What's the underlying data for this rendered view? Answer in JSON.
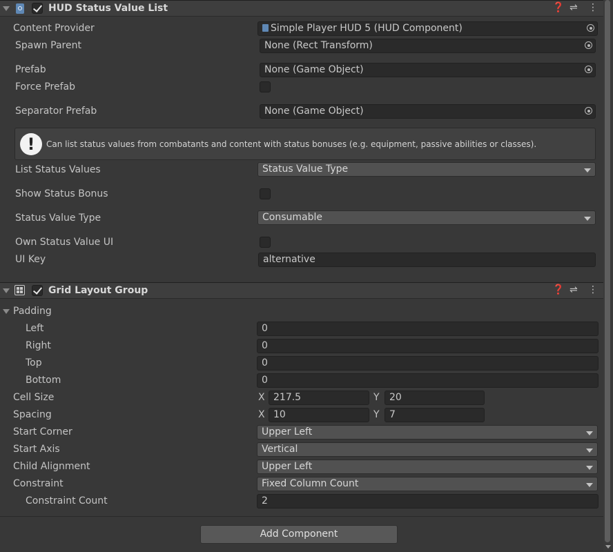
{
  "component1": {
    "title": "HUD Status Value List",
    "icon": "script-icon",
    "enabled": true,
    "fields": {
      "content_provider": {
        "label": "Content Provider",
        "value": "Simple Player HUD 5 (HUD Component)"
      },
      "spawn_parent": {
        "label": "Spawn Parent",
        "value": "None (Rect Transform)"
      },
      "prefab": {
        "label": "Prefab",
        "value": "None (Game Object)"
      },
      "force_prefab": {
        "label": "Force Prefab",
        "checked": false
      },
      "separator_prefab": {
        "label": "Separator Prefab",
        "value": "None (Game Object)"
      },
      "help": "Can list status values from combatants and content with status bonuses (e.g. equipment, passive abilities or classes).",
      "list_status_values": {
        "label": "List Status Values",
        "value": "Status Value Type"
      },
      "show_status_bonus": {
        "label": "Show Status Bonus",
        "checked": false
      },
      "status_value_type": {
        "label": "Status Value Type",
        "value": "Consumable"
      },
      "own_status_value_ui": {
        "label": "Own Status Value UI",
        "checked": false
      },
      "ui_key": {
        "label": "UI Key",
        "value": "alternative"
      }
    }
  },
  "component2": {
    "title": "Grid Layout Group",
    "icon": "grid-layout-icon",
    "enabled": true,
    "padding": {
      "label": "Padding",
      "left": {
        "label": "Left",
        "value": "0"
      },
      "right": {
        "label": "Right",
        "value": "0"
      },
      "top": {
        "label": "Top",
        "value": "0"
      },
      "bottom": {
        "label": "Bottom",
        "value": "0"
      }
    },
    "cell_size": {
      "label": "Cell Size",
      "x_label": "X",
      "x": "217.5",
      "y_label": "Y",
      "y": "20"
    },
    "spacing": {
      "label": "Spacing",
      "x_label": "X",
      "x": "10",
      "y_label": "Y",
      "y": "7"
    },
    "start_corner": {
      "label": "Start Corner",
      "value": "Upper Left"
    },
    "start_axis": {
      "label": "Start Axis",
      "value": "Vertical"
    },
    "child_alignment": {
      "label": "Child Alignment",
      "value": "Upper Left"
    },
    "constraint": {
      "label": "Constraint",
      "value": "Fixed Column Count"
    },
    "constraint_count": {
      "label": "Constraint Count",
      "value": "2"
    }
  },
  "footer": {
    "add_component": "Add Component"
  }
}
